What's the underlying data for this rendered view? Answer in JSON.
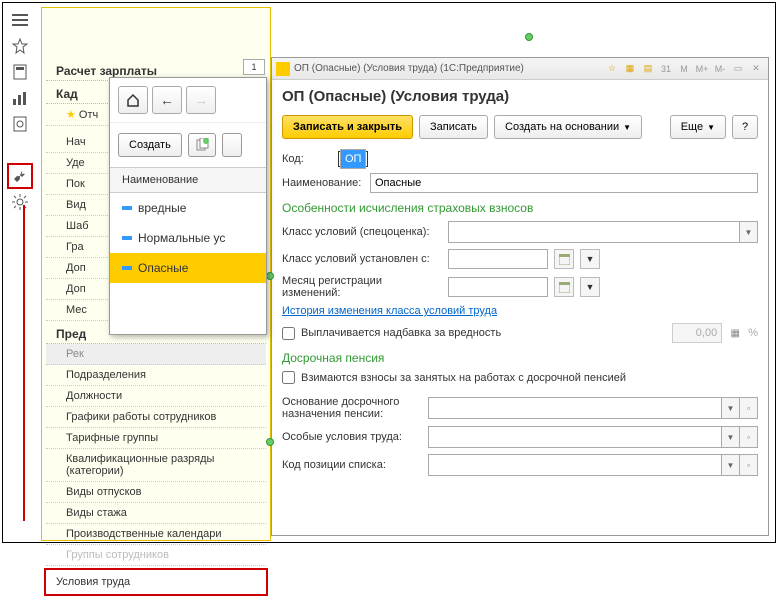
{
  "rail": {
    "icons": [
      "menu",
      "star",
      "calc",
      "chart",
      "safe",
      "wrench",
      "gear"
    ]
  },
  "sidebar": {
    "section1": "Расчет зарплаты",
    "section2": "Кад",
    "starred": "Отч",
    "items1": [
      "Нач",
      "Уде",
      "Пок",
      "Вид",
      "Шаб",
      "Гра",
      "Доп",
      "Доп",
      "Мес"
    ],
    "section3": "Пред",
    "rec": "Рек",
    "items2": [
      "Подразделения",
      "Должности",
      "Графики работы сотрудников",
      "Тарифные группы",
      "Квалификационные разряды (категории)",
      "Виды отпусков",
      "Виды стажа",
      "Производственные календари",
      "Группы сотрудников"
    ],
    "highlighted": "Условия труда"
  },
  "popup": {
    "create": "Создать",
    "header": "Наименование",
    "rows": [
      "вредные",
      "Нормальные ус",
      "Опасные"
    ]
  },
  "tabNumber": "1",
  "window": {
    "title": "ОП (Опасные) (Условия труда)    (1С:Предприятие)",
    "toolbarRight": [
      "31",
      "M",
      "M+",
      "M-"
    ]
  },
  "form": {
    "title": "ОП (Опасные) (Условия труда)",
    "buttons": {
      "saveClose": "Записать и закрыть",
      "save": "Записать",
      "createBased": "Создать на основании",
      "more": "Еще",
      "help": "?"
    },
    "code": {
      "label": "Код:",
      "value": "ОП"
    },
    "name": {
      "label": "Наименование:",
      "value": "Опасные"
    },
    "section1": "Особенности исчисления страховых взносов",
    "classCond": "Класс условий (спецоценка):",
    "classSet": "Класс условий установлен с:",
    "monthReg": "Месяц регистрации изменений:",
    "historyLink": "История изменения класса условий труда",
    "harmBonus": "Выплачивается надбавка за вредность",
    "harmValue": "0,00",
    "section2": "Досрочная пенсия",
    "earlyPensionCheck": "Взимаются взносы за занятых на работах с досрочной пенсией",
    "basis": "Основание досрочного назначения пенсии:",
    "specialCond": "Особые условия труда:",
    "positionCode": "Код позиции списка:"
  }
}
